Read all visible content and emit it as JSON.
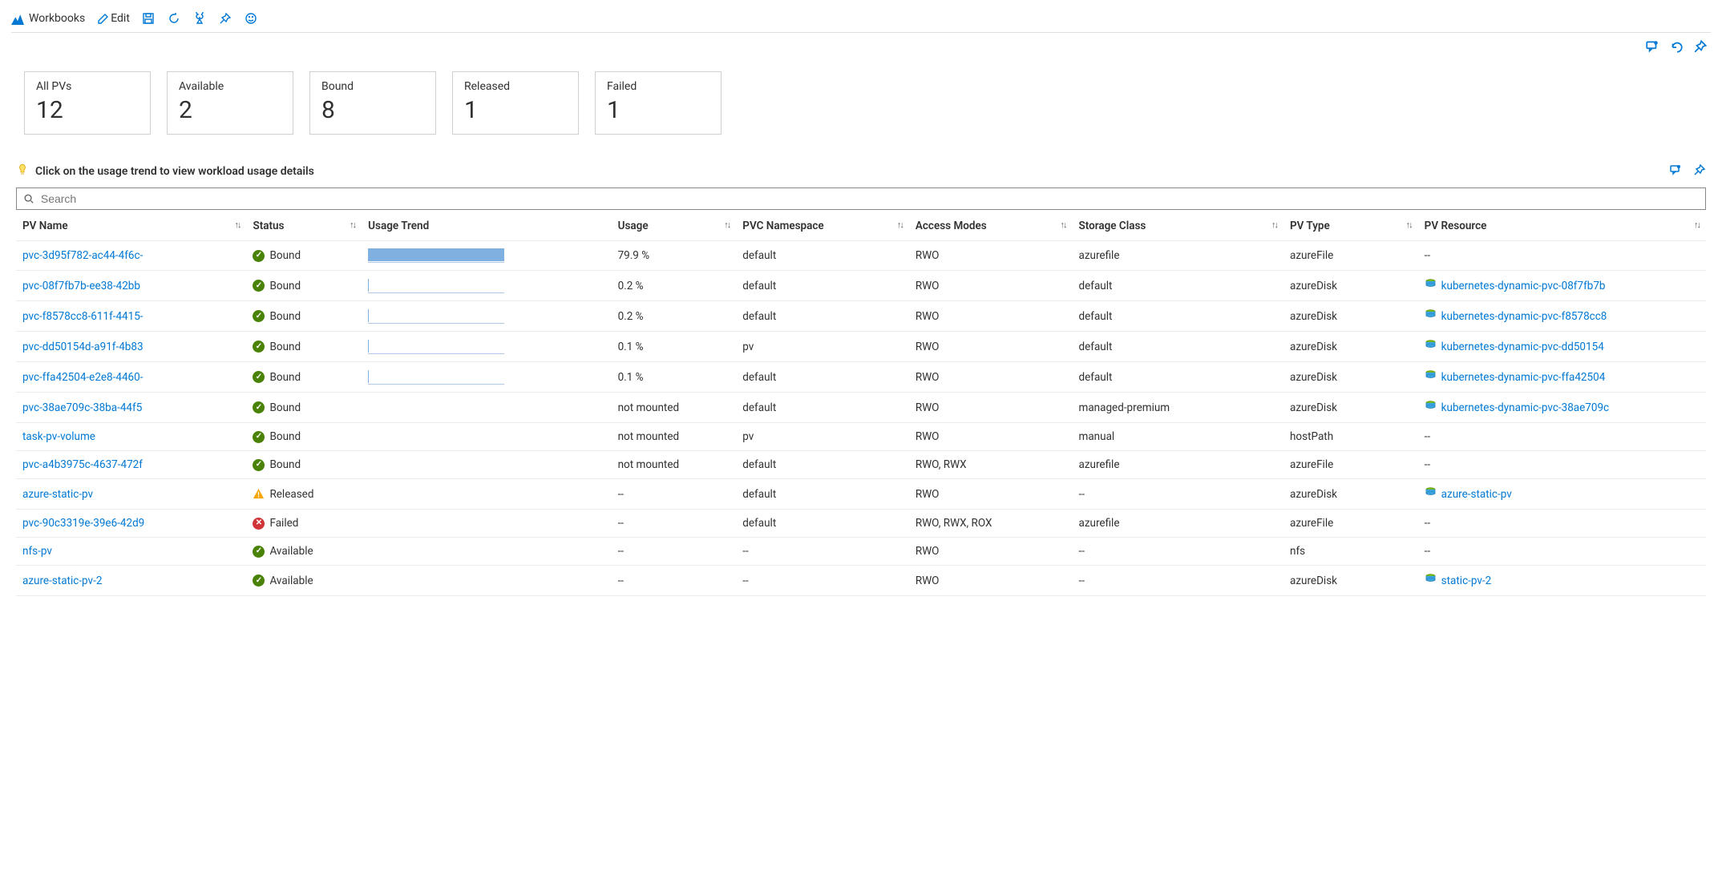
{
  "toolbar": {
    "workbooks": "Workbooks",
    "edit": "Edit"
  },
  "cards": [
    {
      "label": "All PVs",
      "value": "12"
    },
    {
      "label": "Available",
      "value": "2"
    },
    {
      "label": "Bound",
      "value": "8"
    },
    {
      "label": "Released",
      "value": "1"
    },
    {
      "label": "Failed",
      "value": "1"
    }
  ],
  "hint": "Click on the usage trend to view workload usage details",
  "search_placeholder": "Search",
  "columns": {
    "name": "PV Name",
    "status": "Status",
    "trend": "Usage Trend",
    "usage": "Usage",
    "ns": "PVC Namespace",
    "am": "Access Modes",
    "sc": "Storage Class",
    "type": "PV Type",
    "res": "PV Resource"
  },
  "rows": [
    {
      "name": "pvc-3d95f782-ac44-4f6c-",
      "status": "Bound",
      "st": "ok",
      "bar": 100,
      "usage": "79.9 %",
      "ns": "default",
      "am": "RWO",
      "sc": "azurefile",
      "type": "azureFile",
      "res": "--",
      "reslink": false
    },
    {
      "name": "pvc-08f7fb7b-ee38-42bb",
      "status": "Bound",
      "st": "ok",
      "bar": 0.3,
      "usage": "0.2 %",
      "ns": "default",
      "am": "RWO",
      "sc": "default",
      "type": "azureDisk",
      "res": "kubernetes-dynamic-pvc-08f7fb7b",
      "reslink": true
    },
    {
      "name": "pvc-f8578cc8-611f-4415-",
      "status": "Bound",
      "st": "ok",
      "bar": 0.3,
      "usage": "0.2 %",
      "ns": "default",
      "am": "RWO",
      "sc": "default",
      "type": "azureDisk",
      "res": "kubernetes-dynamic-pvc-f8578cc8",
      "reslink": true
    },
    {
      "name": "pvc-dd50154d-a91f-4b83",
      "status": "Bound",
      "st": "ok",
      "bar": 0.2,
      "usage": "0.1 %",
      "ns": "pv",
      "am": "RWO",
      "sc": "default",
      "type": "azureDisk",
      "res": "kubernetes-dynamic-pvc-dd50154",
      "reslink": true
    },
    {
      "name": "pvc-ffa42504-e2e8-4460-",
      "status": "Bound",
      "st": "ok",
      "bar": 0.2,
      "usage": "0.1 %",
      "ns": "default",
      "am": "RWO",
      "sc": "default",
      "type": "azureDisk",
      "res": "kubernetes-dynamic-pvc-ffa42504",
      "reslink": true
    },
    {
      "name": "pvc-38ae709c-38ba-44f5",
      "status": "Bound",
      "st": "ok",
      "bar": null,
      "usage": "not mounted",
      "ns": "default",
      "am": "RWO",
      "sc": "managed-premium",
      "type": "azureDisk",
      "res": "kubernetes-dynamic-pvc-38ae709c",
      "reslink": true
    },
    {
      "name": "task-pv-volume",
      "status": "Bound",
      "st": "ok",
      "bar": null,
      "usage": "not mounted",
      "ns": "pv",
      "am": "RWO",
      "sc": "manual",
      "type": "hostPath",
      "res": "--",
      "reslink": false
    },
    {
      "name": "pvc-a4b3975c-4637-472f",
      "status": "Bound",
      "st": "ok",
      "bar": null,
      "usage": "not mounted",
      "ns": "default",
      "am": "RWO, RWX",
      "sc": "azurefile",
      "type": "azureFile",
      "res": "--",
      "reslink": false
    },
    {
      "name": "azure-static-pv",
      "status": "Released",
      "st": "warn",
      "bar": null,
      "usage": "--",
      "ns": "default",
      "am": "RWO",
      "sc": "--",
      "type": "azureDisk",
      "res": "azure-static-pv",
      "reslink": true
    },
    {
      "name": "pvc-90c3319e-39e6-42d9",
      "status": "Failed",
      "st": "fail",
      "bar": null,
      "usage": "--",
      "ns": "default",
      "am": "RWO, RWX, ROX",
      "sc": "azurefile",
      "type": "azureFile",
      "res": "--",
      "reslink": false
    },
    {
      "name": "nfs-pv",
      "status": "Available",
      "st": "ok",
      "bar": null,
      "usage": "--",
      "ns": "--",
      "am": "RWO",
      "sc": "--",
      "type": "nfs",
      "res": "--",
      "reslink": false
    },
    {
      "name": "azure-static-pv-2",
      "status": "Available",
      "st": "ok",
      "bar": null,
      "usage": "--",
      "ns": "--",
      "am": "RWO",
      "sc": "--",
      "type": "azureDisk",
      "res": "static-pv-2",
      "reslink": true
    }
  ]
}
